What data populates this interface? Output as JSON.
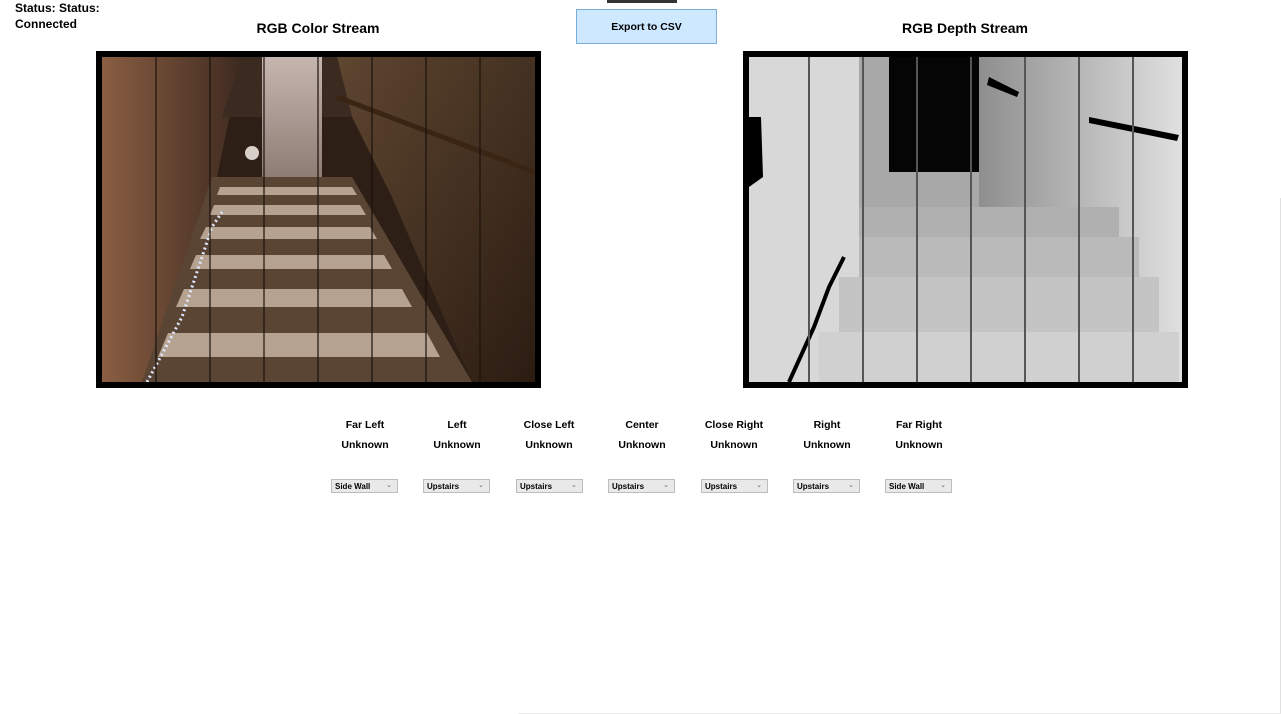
{
  "status": {
    "text": "Status: Status: Connected"
  },
  "toolbar": {
    "export_label": "Export to CSV"
  },
  "streams": {
    "color_title": "RGB Color Stream",
    "depth_title": "RGB Depth Stream"
  },
  "zones": [
    {
      "name": "Far Left",
      "state": "Unknown",
      "selected": "Side Wall"
    },
    {
      "name": "Left",
      "state": "Unknown",
      "selected": "Upstairs"
    },
    {
      "name": "Close Left",
      "state": "Unknown",
      "selected": "Upstairs"
    },
    {
      "name": "Center",
      "state": "Unknown",
      "selected": "Upstairs"
    },
    {
      "name": "Close Right",
      "state": "Unknown",
      "selected": "Upstairs"
    },
    {
      "name": "Right",
      "state": "Unknown",
      "selected": "Upstairs"
    },
    {
      "name": "Far Right",
      "state": "Unknown",
      "selected": "Side Wall"
    }
  ],
  "icons": {
    "dropdown": "chevron-down-icon"
  }
}
